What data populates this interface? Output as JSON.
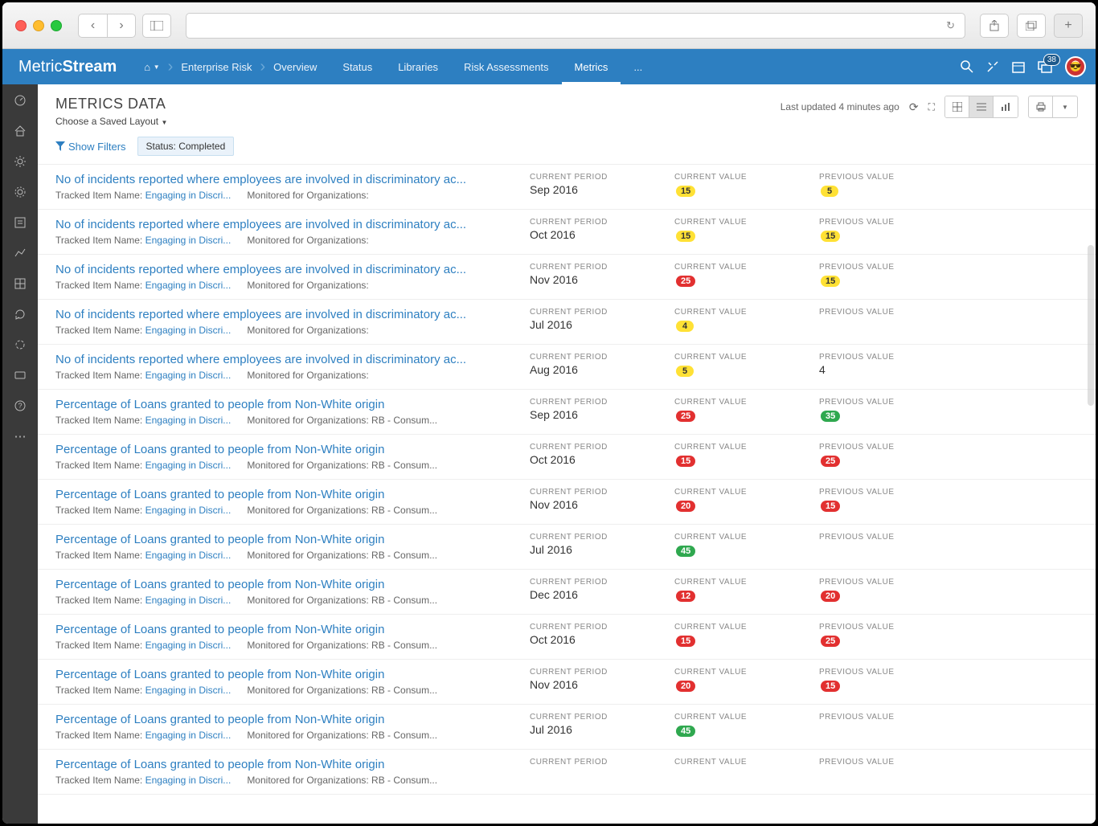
{
  "app": {
    "logo_a": "Metric",
    "logo_b": "Stream"
  },
  "breadcrumb": {
    "items": [
      {
        "label": "Enterprise Risk"
      },
      {
        "label": "Overview"
      },
      {
        "label": "Status"
      },
      {
        "label": "Libraries"
      },
      {
        "label": "Risk Assessments"
      },
      {
        "label": "Metrics"
      },
      {
        "label": "..."
      }
    ]
  },
  "header_badge": "38",
  "page": {
    "title": "METRICS DATA",
    "saved_layout": "Choose a Saved Layout",
    "last_updated": "Last updated 4 minutes ago"
  },
  "filters": {
    "show_label": "Show Filters",
    "chip": "Status: Completed"
  },
  "labels": {
    "current_period": "CURRENT PERIOD",
    "current_value": "CURRENT VALUE",
    "previous_value": "PREVIOUS VALUE",
    "tracked_prefix": "Tracked Item Name: ",
    "tracked_link": "Engaging in Discri...",
    "monitored_prefix": "Monitored for Organizations:",
    "monitored_suffix": " RB - Consum..."
  },
  "rows": [
    {
      "title": "No of incidents reported where employees are involved in discriminatory ac...",
      "org": "",
      "period": "Sep 2016",
      "cv": "15",
      "cvc": "yellow",
      "pv": "5",
      "pvc": "yellow"
    },
    {
      "title": "No of incidents reported where employees are involved in discriminatory ac...",
      "org": "",
      "period": "Oct 2016",
      "cv": "15",
      "cvc": "yellow",
      "pv": "15",
      "pvc": "yellow"
    },
    {
      "title": "No of incidents reported where employees are involved in discriminatory ac...",
      "org": "",
      "period": "Nov 2016",
      "cv": "25",
      "cvc": "red",
      "pv": "15",
      "pvc": "yellow"
    },
    {
      "title": "No of incidents reported where employees are involved in discriminatory ac...",
      "org": "",
      "period": "Jul 2016",
      "cv": "4",
      "cvc": "yellow",
      "pv": "",
      "pvc": ""
    },
    {
      "title": "No of incidents reported where employees are involved in discriminatory ac...",
      "org": "",
      "period": "Aug 2016",
      "cv": "5",
      "cvc": "yellow",
      "pv": "4",
      "pvc": ""
    },
    {
      "title": "Percentage of Loans granted to people from Non-White origin",
      "org": "rb",
      "period": "Sep 2016",
      "cv": "25",
      "cvc": "red",
      "pv": "35",
      "pvc": "green"
    },
    {
      "title": "Percentage of Loans granted to people from Non-White origin",
      "org": "rb",
      "period": "Oct 2016",
      "cv": "15",
      "cvc": "red",
      "pv": "25",
      "pvc": "red"
    },
    {
      "title": "Percentage of Loans granted to people from Non-White origin",
      "org": "rb",
      "period": "Nov 2016",
      "cv": "20",
      "cvc": "red",
      "pv": "15",
      "pvc": "red"
    },
    {
      "title": "Percentage of Loans granted to people from Non-White origin",
      "org": "rb",
      "period": "Jul 2016",
      "cv": "45",
      "cvc": "green",
      "pv": "",
      "pvc": ""
    },
    {
      "title": "Percentage of Loans granted to people from Non-White origin",
      "org": "rb",
      "period": "Dec 2016",
      "cv": "12",
      "cvc": "red",
      "pv": "20",
      "pvc": "red"
    },
    {
      "title": "Percentage of Loans granted to people from Non-White origin",
      "org": "rb",
      "period": "Oct 2016",
      "cv": "15",
      "cvc": "red",
      "pv": "25",
      "pvc": "red"
    },
    {
      "title": "Percentage of Loans granted to people from Non-White origin",
      "org": "rb",
      "period": "Nov 2016",
      "cv": "20",
      "cvc": "red",
      "pv": "15",
      "pvc": "red"
    },
    {
      "title": "Percentage of Loans granted to people from Non-White origin",
      "org": "rb",
      "period": "Jul 2016",
      "cv": "45",
      "cvc": "green",
      "pv": "",
      "pvc": ""
    },
    {
      "title": "Percentage of Loans granted to people from Non-White origin",
      "org": "rb",
      "period": "",
      "cv": "",
      "cvc": "red",
      "pv": "",
      "pvc": "red"
    }
  ]
}
